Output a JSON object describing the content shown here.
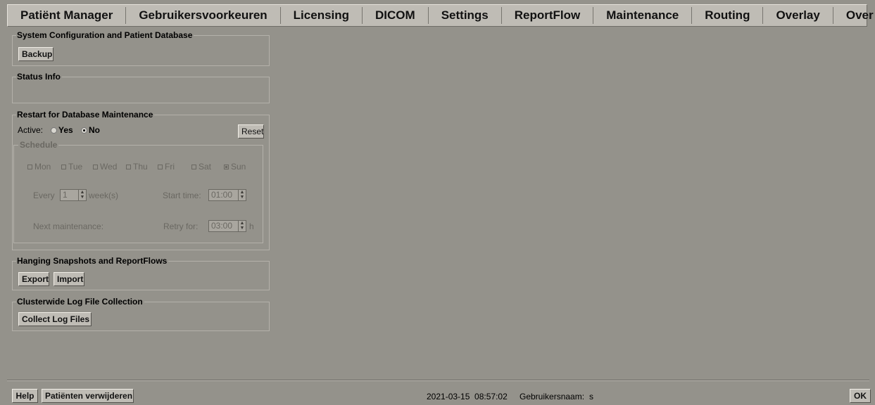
{
  "tabs": [
    {
      "label": "Patiënt Manager"
    },
    {
      "label": "Gebruikersvoorkeuren"
    },
    {
      "label": "Licensing"
    },
    {
      "label": "DICOM"
    },
    {
      "label": "Settings"
    },
    {
      "label": "ReportFlow"
    },
    {
      "label": "Maintenance"
    },
    {
      "label": "Routing"
    },
    {
      "label": "Overlay"
    },
    {
      "label": "Over"
    }
  ],
  "active_tab": "Maintenance",
  "system_config": {
    "title": "System Configuration and Patient Database",
    "backup_label": "Backup"
  },
  "status_info": {
    "title": "Status Info"
  },
  "restart": {
    "title": "Restart for Database Maintenance",
    "active_label": "Active:",
    "yes_label": "Yes",
    "no_label": "No",
    "active_value": "No",
    "reset_label": "Reset",
    "schedule": {
      "title": "Schedule",
      "days": [
        {
          "label": "Mon",
          "checked": false
        },
        {
          "label": "Tue",
          "checked": false
        },
        {
          "label": "Wed",
          "checked": false
        },
        {
          "label": "Thu",
          "checked": false
        },
        {
          "label": "Fri",
          "checked": false
        },
        {
          "label": "Sat",
          "checked": false
        },
        {
          "label": "Sun",
          "checked": true
        }
      ],
      "every_label": "Every",
      "every_value": "1",
      "weeks_label": "week(s)",
      "start_time_label": "Start time:",
      "start_time_value": "01:00",
      "next_maintenance_label": "Next maintenance:",
      "retry_label": "Retry for:",
      "retry_value": "03:00",
      "retry_unit": "h"
    }
  },
  "hanging": {
    "title": "Hanging Snapshots and ReportFlows",
    "export_label": "Export",
    "import_label": "Import"
  },
  "log_collection": {
    "title": "Clusterwide Log File Collection",
    "collect_label": "Collect Log Files"
  },
  "footer": {
    "help_label": "Help",
    "delete_patients_label": "Patiënten verwijderen",
    "datetime": "2021-03-15  08:57:02",
    "username_label": "Gebruikersnaam:",
    "username_value": "s",
    "ok_label": "OK"
  },
  "colors": {
    "background": "#94928b",
    "tabbar": "#bfbcb5",
    "button": "#bfbcb5",
    "disabled_text": "#6a6862"
  }
}
